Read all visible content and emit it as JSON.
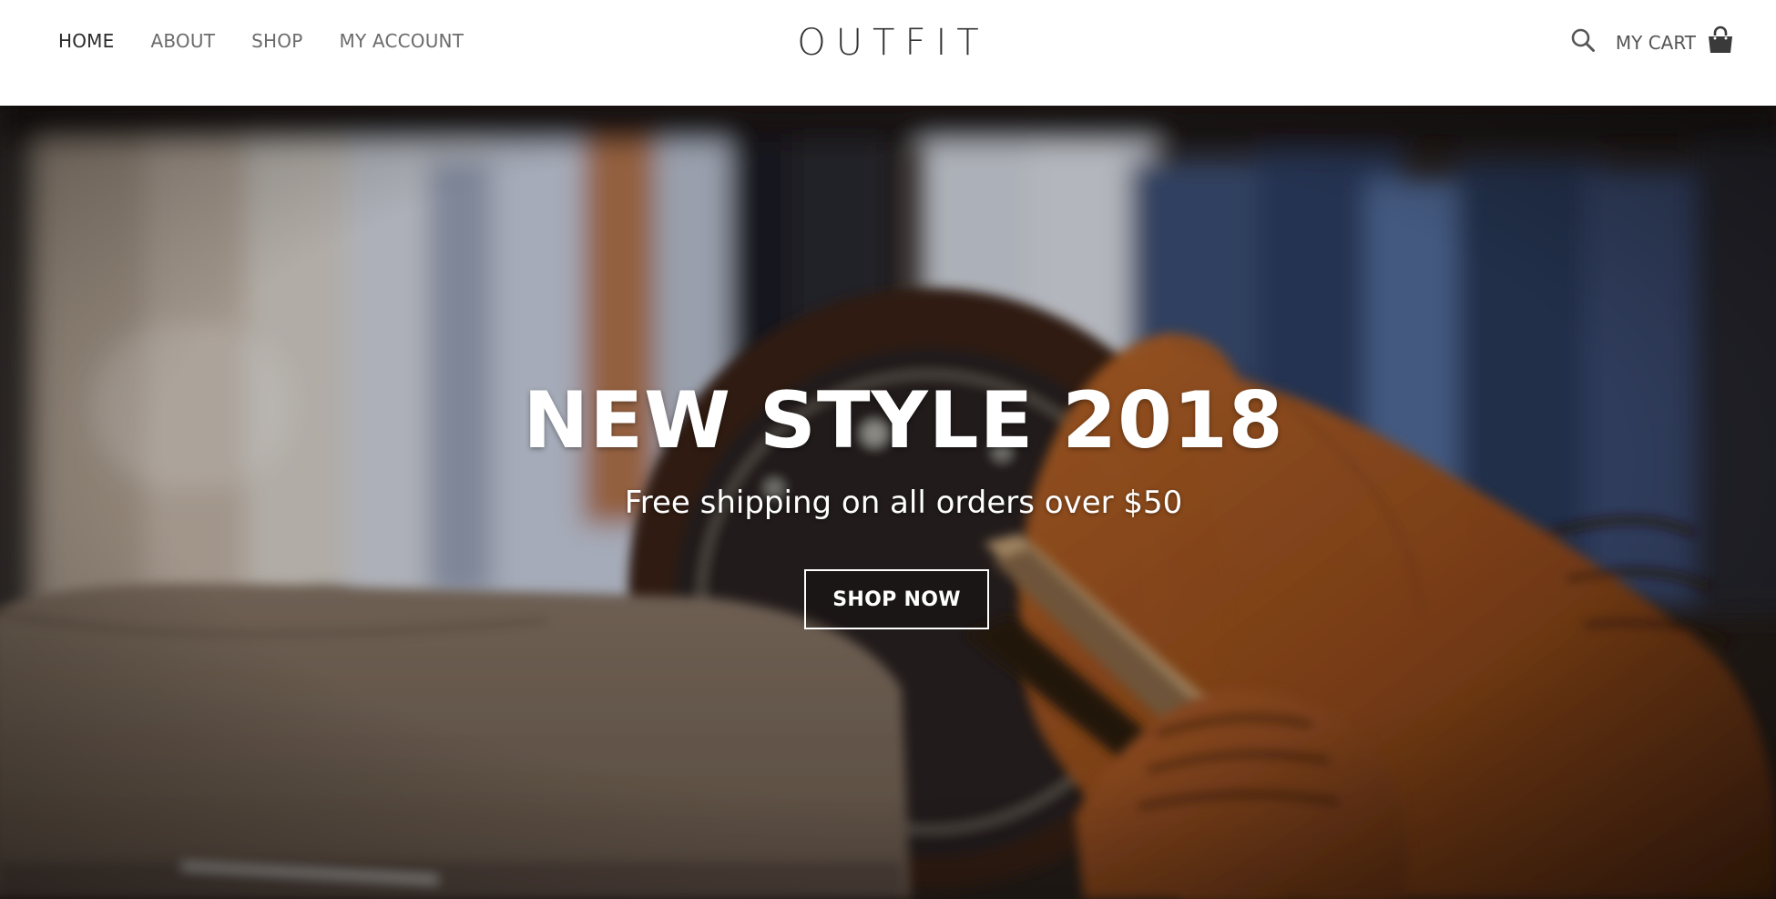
{
  "header": {
    "nav": [
      {
        "label": "HOME",
        "active": true
      },
      {
        "label": "ABOUT",
        "active": false
      },
      {
        "label": "SHOP",
        "active": false
      },
      {
        "label": "MY ACCOUNT",
        "active": false
      }
    ],
    "logo": "OUTFIT",
    "search_icon": "search-icon",
    "cart_label": "MY CART",
    "cart_icon": "shopping-bag-icon"
  },
  "hero": {
    "title": "NEW STYLE 2018",
    "subtitle": "Free shipping on all orders over $50",
    "cta_label": "SHOP NOW"
  },
  "colors": {
    "nav_text": "#6b6b6b",
    "nav_active": "#2a2a2a",
    "logo": "#333333",
    "hero_text": "#ffffff",
    "leather": "#a0521f"
  }
}
